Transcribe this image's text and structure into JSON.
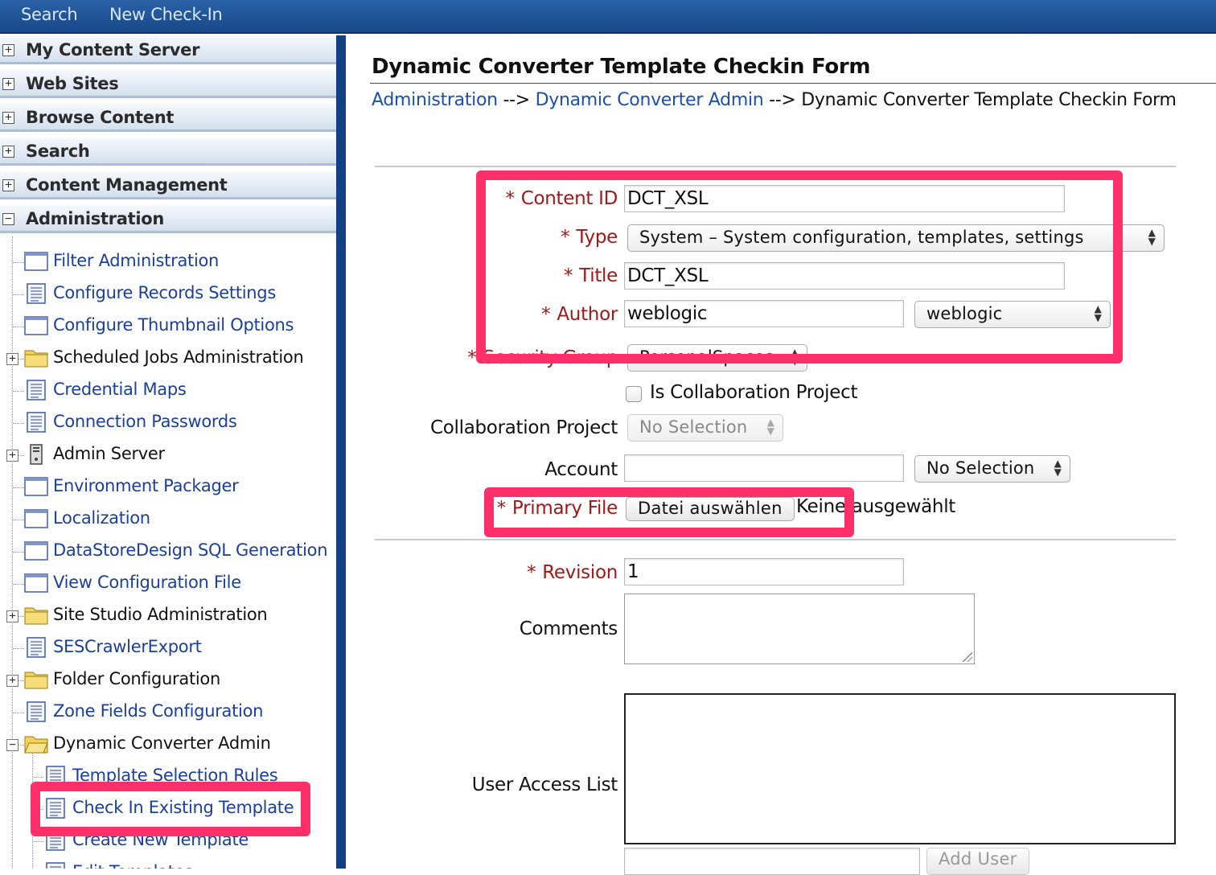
{
  "topbar": {
    "search": "Search",
    "new_checkin": "New Check-In"
  },
  "nav": {
    "sections": [
      {
        "label": "My Content Server",
        "toggle": "+"
      },
      {
        "label": "Web Sites",
        "toggle": "+"
      },
      {
        "label": "Browse Content",
        "toggle": "+"
      },
      {
        "label": "Search",
        "toggle": "+"
      },
      {
        "label": "Content Management",
        "toggle": "+"
      },
      {
        "label": "Administration",
        "toggle": "−"
      }
    ],
    "admin_items": [
      {
        "label": "Filter Administration",
        "icon": "page-icon"
      },
      {
        "label": "Configure Records Settings",
        "icon": "document-icon"
      },
      {
        "label": "Configure Thumbnail Options",
        "icon": "page-icon"
      },
      {
        "label": "Scheduled Jobs Administration",
        "icon": "folder-icon"
      },
      {
        "label": "Credential Maps",
        "icon": "document-icon"
      },
      {
        "label": "Connection Passwords",
        "icon": "document-icon"
      },
      {
        "label": "Admin Server",
        "icon": "server-icon"
      },
      {
        "label": "Environment Packager",
        "icon": "page-icon"
      },
      {
        "label": "Localization",
        "icon": "page-icon"
      },
      {
        "label": "DataStoreDesign SQL Generation",
        "icon": "page-icon"
      },
      {
        "label": "View Configuration File",
        "icon": "page-icon"
      },
      {
        "label": "Site Studio Administration",
        "icon": "folder-icon"
      },
      {
        "label": "SESCrawlerExport",
        "icon": "document-icon"
      },
      {
        "label": "Folder Configuration",
        "icon": "folder-icon"
      },
      {
        "label": "Zone Fields Configuration",
        "icon": "document-icon"
      },
      {
        "label": "Dynamic Converter Admin",
        "icon": "folder-open-icon"
      }
    ],
    "dc_items": [
      {
        "label": "Template Selection Rules",
        "icon": "document-icon"
      },
      {
        "label": "Check In Existing Template",
        "icon": "document-icon"
      },
      {
        "label": "Create New Template",
        "icon": "document-icon"
      },
      {
        "label": "Edit Templates",
        "icon": "document-icon"
      }
    ]
  },
  "page": {
    "title": "Dynamic Converter Template Checkin Form",
    "breadcrumb": {
      "link1": "Administration",
      "sep": " --> ",
      "link2": "Dynamic Converter Admin",
      "current": "Dynamic Converter Template Checkin Form"
    }
  },
  "form": {
    "required_mark": "*",
    "content_id": {
      "label": "Content ID",
      "value": "DCT_XSL"
    },
    "type": {
      "label": "Type",
      "value": "System – System configuration, templates, settings"
    },
    "title": {
      "label": "Title",
      "value": "DCT_XSL"
    },
    "author": {
      "label": "Author",
      "value": "weblogic",
      "select": "weblogic"
    },
    "security_group": {
      "label": "Security Group",
      "value": "PersonalSpaces"
    },
    "collab_check": {
      "label": "Is Collaboration Project"
    },
    "collab_project": {
      "label": "Collaboration Project",
      "value": "No Selection"
    },
    "account": {
      "label": "Account",
      "value": "",
      "select": "No Selection"
    },
    "primary_file": {
      "label": "Primary File",
      "button": "Datei auswählen",
      "status": "Keine ausgewählt"
    },
    "revision": {
      "label": "Revision",
      "value": "1"
    },
    "comments": {
      "label": "Comments"
    },
    "user_access": {
      "label": "User Access List",
      "add_button": "Add User"
    }
  },
  "colors": {
    "highlight": "#ff2f6a",
    "required": "#a01818",
    "link": "#1b4fb0",
    "topbar": "#1f4f93"
  }
}
